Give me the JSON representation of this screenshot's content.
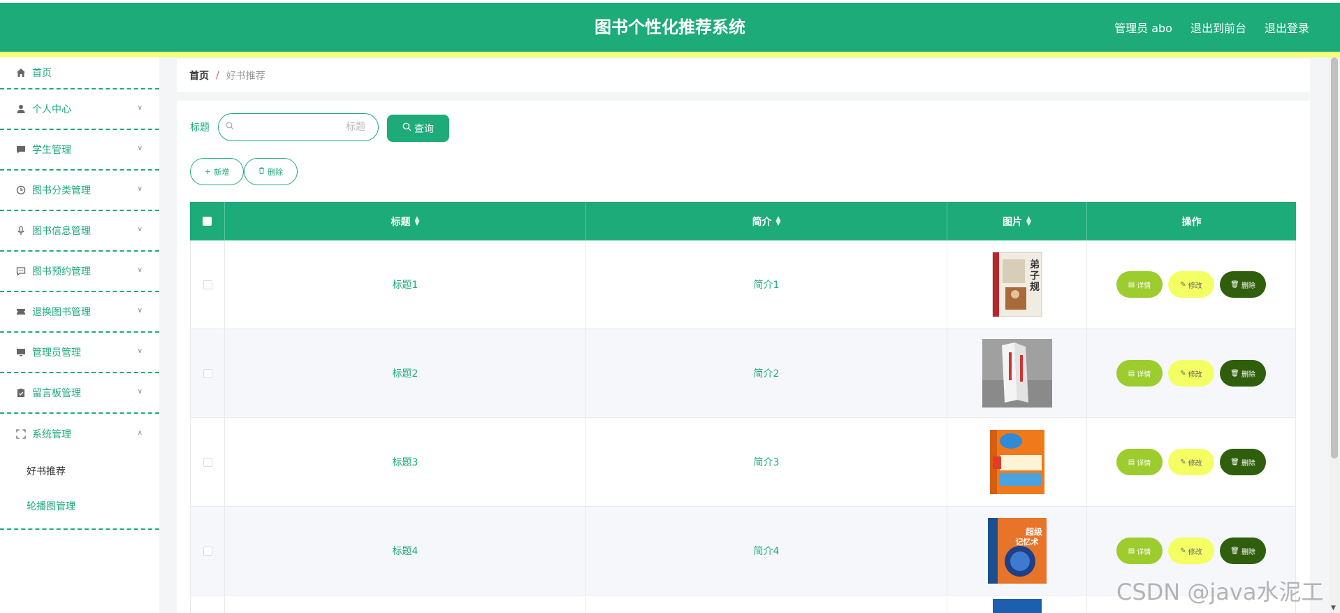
{
  "header": {
    "title": "图书个性化推荐系统",
    "admin_label": "管理员 abo",
    "front_label": "退出到前台",
    "logout_label": "退出登录"
  },
  "sidebar": {
    "items": [
      {
        "label": "首页",
        "icon": "home-icon"
      },
      {
        "label": "个人中心",
        "icon": "user-icon"
      },
      {
        "label": "学生管理",
        "icon": "chat-icon"
      },
      {
        "label": "图书分类管理",
        "icon": "clock-icon"
      },
      {
        "label": "图书信息管理",
        "icon": "mic-icon"
      },
      {
        "label": "图书预约管理",
        "icon": "message-icon"
      },
      {
        "label": "退换图书管理",
        "icon": "ticket-icon"
      },
      {
        "label": "管理员管理",
        "icon": "monitor-icon"
      },
      {
        "label": "留言板管理",
        "icon": "clipboard-icon"
      },
      {
        "label": "系统管理",
        "icon": "fullscreen-icon"
      }
    ],
    "submenu": [
      {
        "label": "好书推荐",
        "active": true
      },
      {
        "label": "轮播图管理",
        "active": false
      }
    ]
  },
  "breadcrumb": {
    "home": "首页",
    "separator": "/",
    "current": "好书推荐"
  },
  "search": {
    "label": "标题",
    "placeholder": "标题",
    "value": "",
    "button": "查询"
  },
  "toolbar": {
    "add": "新增",
    "delete": "删除"
  },
  "table": {
    "columns": [
      "标题",
      "简介",
      "图片",
      "操作"
    ],
    "rows": [
      {
        "title": "标题1",
        "intro": "简介1"
      },
      {
        "title": "标题2",
        "intro": "简介2"
      },
      {
        "title": "标题3",
        "intro": "简介3"
      },
      {
        "title": "标题4",
        "intro": "简介4"
      }
    ],
    "actions": {
      "detail": "详情",
      "edit": "修改",
      "delete": "删除"
    }
  },
  "watermark": "CSDN @java水泥工",
  "colors": {
    "primary": "#1dab7a",
    "strip": "#f2ff7a",
    "detail": "#9ccc2d",
    "edit": "#f3ff62",
    "delete": "#2f5e0d"
  }
}
